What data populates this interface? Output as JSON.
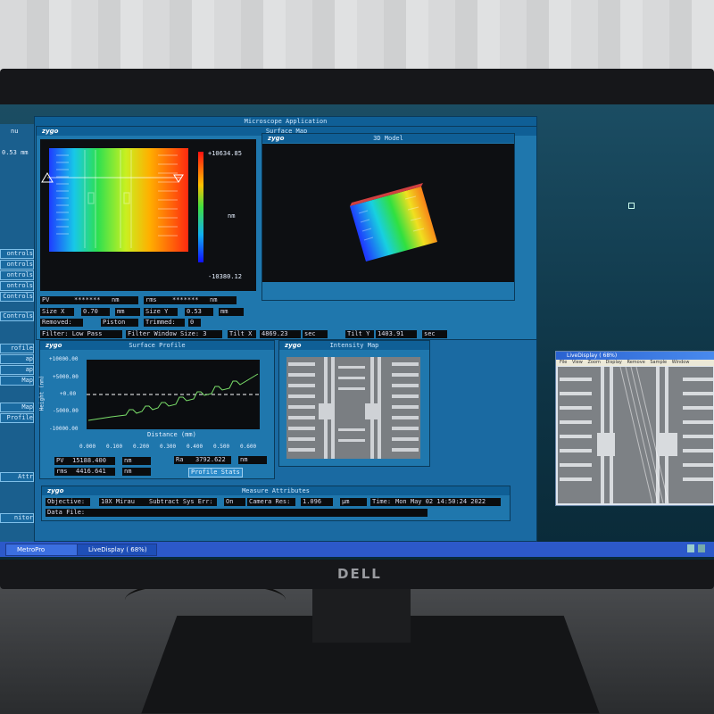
{
  "app": {
    "window_title": "Microscope Application",
    "brand_logo": "zygo",
    "monitor_brand": "DELL"
  },
  "left_panel": {
    "partial_labels": [
      "nu",
      "0.53 mm"
    ],
    "buttons": [
      "ontrols",
      "ontrols",
      "ontrols",
      "ontrols",
      "Controls",
      "Controls",
      "rofile",
      "ap",
      "ap",
      "Map",
      "Map",
      "Profile",
      "Attr",
      "nitor"
    ]
  },
  "surface_map": {
    "title": "Surface Map",
    "colorbar_max": "+10634.85",
    "colorbar_min": "-10380.12",
    "colorbar_unit": "nm",
    "model_title": "3D Model",
    "fields": {
      "pv_label": "PV",
      "pv_value": "*******",
      "pv_unit": "nm",
      "rms_label": "rms",
      "rms_value": "*******",
      "rms_unit": "nm",
      "sizex_label": "Size X",
      "sizex_value": "0.70",
      "sizex_unit": "mm",
      "sizey_label": "Size Y",
      "sizey_value": "0.53",
      "sizey_unit": "mm",
      "removed_label": "Removed:",
      "removed_value": "Piston",
      "trimmed_label": "Trimmed:",
      "trimmed_value": "0",
      "filter": "Filter:  Low Pass",
      "filter_window": "Filter Window Size: 3",
      "tiltx_label": "Tilt X",
      "tiltx_value": "4869.23",
      "tiltx_unit": "sec",
      "tilty_label": "Tilt Y",
      "tilty_value": "1403.91",
      "tilty_unit": "sec"
    }
  },
  "surface_profile": {
    "title": "Surface Profile",
    "ylabel": "Height (nm)",
    "xlabel": "Distance (mm)",
    "yticks": [
      "+10000.00",
      "+5000.00",
      "+0.00",
      "-5000.00",
      "-10000.00"
    ],
    "xticks": [
      "0.000",
      "0.100",
      "0.200",
      "0.300",
      "0.400",
      "0.500",
      "0.600"
    ],
    "pv_label": "PV",
    "pv_value": "15188.400",
    "pv_unit": "nm",
    "rms_label": "rms",
    "rms_value": "4416.641",
    "rms_unit": "nm",
    "ra_label": "Ra",
    "ra_value": "3792.622",
    "ra_unit": "nm",
    "stats_button": "Profile Stats"
  },
  "intensity_map": {
    "title": "Intensity Map"
  },
  "measure_attributes": {
    "title": "Measure Attributes",
    "objective_label": "Objective:",
    "objective_value": "10X  Mirau",
    "subtract_label": "Subtract Sys Err:",
    "subtract_value": "On",
    "camera_label": "Camera Res:",
    "camera_value": "1.096",
    "camera_unit": "µm",
    "time_label": "Time:",
    "time_value": "Mon May 02 14:50:24 2022",
    "datafile_label": "Data File:",
    "datafile_value": ""
  },
  "taskbar": {
    "items": [
      "MetroPro",
      "LiveDisplay ( 68%)"
    ]
  },
  "live_display": {
    "title": "LiveDisplay ( 68%)",
    "menu": [
      "File",
      "View",
      "Zoom",
      "Display",
      "Remove",
      "Sample",
      "Window"
    ]
  },
  "colors": {
    "screen_bg": "#0e3445",
    "window_blue": "#1f77ad",
    "titlebar": "#0f5f96",
    "profile_line": "#7be06a",
    "taskbar": "#2c59c9"
  }
}
